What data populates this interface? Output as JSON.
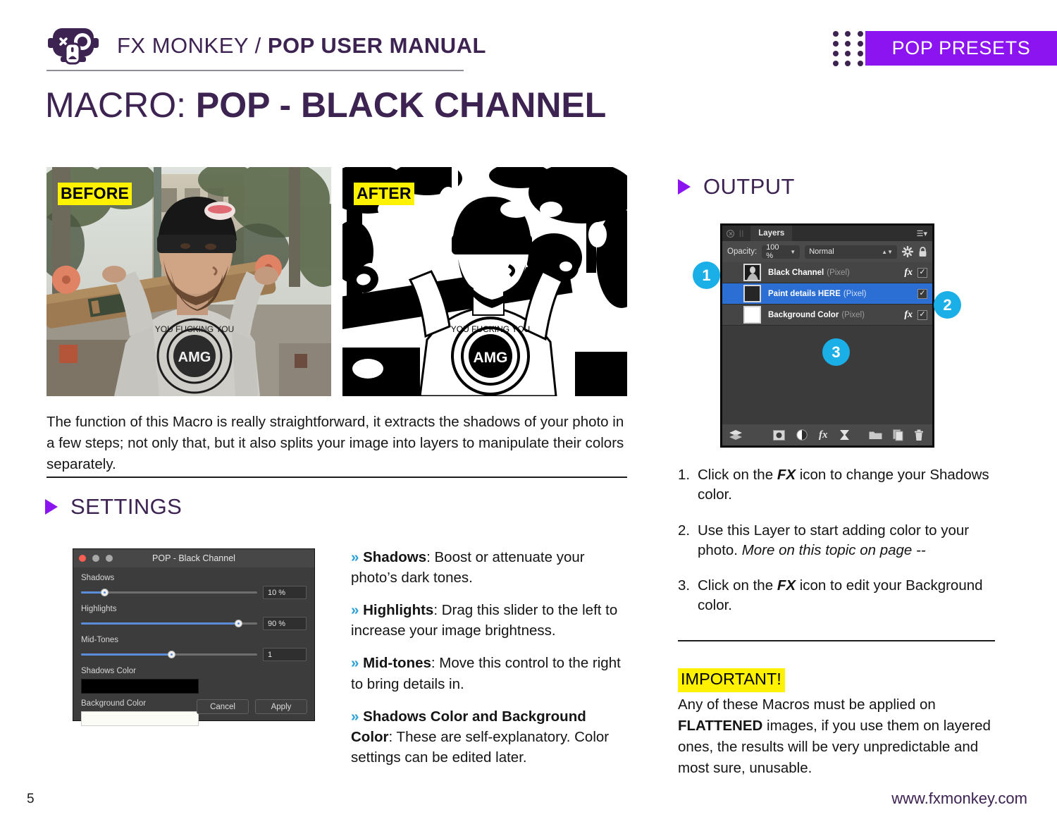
{
  "header": {
    "brand_light": "FX MONKEY / ",
    "brand_bold": "POP USER MANUAL",
    "logo_icon": "fx-monkey-logo-icon",
    "preset_tag": "POP PRESETS",
    "dot_grid_icon": "dot-grid-icon",
    "accent_purple": "#8b14f0",
    "dark_purple": "#3d2352"
  },
  "title": {
    "light": "MACRO: ",
    "bold": "POP - BLACK CHANNEL"
  },
  "photos": {
    "before": {
      "label": "BEFORE",
      "alt": "Color photo of bearded man wearing black beanie carrying a longboard on his shoulders"
    },
    "after": {
      "label": "AFTER",
      "alt": "High contrast black and white version of the same photo"
    },
    "highlight_color": "#fff200"
  },
  "description": "The function of this Macro is really straightforward, it extracts the shadows of your photo in a few steps; not only that, but it also splits your image into layers to manipulate their colors separately.",
  "sections": {
    "settings": {
      "label": "SETTINGS",
      "icon": "triangle-right-icon"
    },
    "output": {
      "label": "OUTPUT",
      "icon": "triangle-right-icon"
    }
  },
  "dialog": {
    "title": "POP - Black Channel",
    "traffic_lights": [
      "#ff5f52",
      "#a8a8a8",
      "#a8a8a8"
    ],
    "fields": [
      {
        "label": "Shadows",
        "value": "10 %",
        "fill_pct": 13
      },
      {
        "label": "Highlights",
        "value": "90 %",
        "fill_pct": 89
      },
      {
        "label": "Mid-Tones",
        "value": "1",
        "fill_pct": 51
      }
    ],
    "swatches": [
      {
        "label": "Shadows Color",
        "color": "#000000"
      },
      {
        "label": "Background Color",
        "color": "#fcfcf7"
      }
    ],
    "cancel_label": "Cancel",
    "apply_label": "Apply"
  },
  "settings_bullets": [
    {
      "marker": "»",
      "term": "Shadows",
      "text": ": Boost or attenuate your photo’s dark tones."
    },
    {
      "marker": "»",
      "term": "Highlights",
      "text": ": Drag this slider to the left to increase your image brightness."
    },
    {
      "marker": "»",
      "term": "Mid-tones",
      "text": ": Move this control to the right to bring details in."
    },
    {
      "marker": "»",
      "term": "Shadows Color and Background Color",
      "text": ": These are self-explanatory. Color settings can be edited later."
    }
  ],
  "layers_panel": {
    "tab_label": "Layers",
    "close_icon": "close-circle-icon",
    "pause_icon": "pause-bars-icon",
    "menu_icon": "panel-menu-icon",
    "opacity_label": "Opacity:",
    "opacity_value": "100 %",
    "blend_mode": "Normal",
    "gear_icon": "gear-icon",
    "lock_icon": "lock-icon",
    "layers": [
      {
        "name": "Black Channel",
        "type": "(Pixel)",
        "selected": false,
        "has_fx": true,
        "checked": true,
        "thumb": "photo-thumb"
      },
      {
        "name": "Paint details HERE",
        "type": "(Pixel)",
        "selected": true,
        "has_fx": false,
        "checked": true,
        "thumb": "dark-thumb"
      },
      {
        "name": "Background Color",
        "type": "(Pixel)",
        "selected": false,
        "has_fx": true,
        "checked": true,
        "thumb": "white-thumb"
      }
    ],
    "bottom_icons": [
      "layers-stack-icon",
      "mask-icon",
      "adjustment-icon",
      "fx-icon",
      "filter-hourglass-icon",
      "folder-icon",
      "duplicate-icon",
      "trash-icon"
    ],
    "selected_color": "#2b6ed4",
    "badges": [
      "1",
      "2",
      "3"
    ],
    "badge_color": "#1aafe6"
  },
  "steps": [
    {
      "num": "1.",
      "pre": "Click on the ",
      "bold": "FX",
      "post": " icon to change your Shadows color.",
      "italic": ""
    },
    {
      "num": "2.",
      "pre": "Use this Layer to start adding color to your photo. ",
      "bold": "",
      "post": "",
      "italic": "More on this topic on page --"
    },
    {
      "num": "3.",
      "pre": "Click on the ",
      "bold": "FX",
      "post": " icon to edit your Background color.",
      "italic": ""
    }
  ],
  "important": {
    "tag": "IMPORTANT!",
    "pre": "Any of these Macros must be applied on ",
    "bold": "FLATTENED",
    "post": " images, if you use them on layered ones, the results will be very unpredictable and most sure, unusable."
  },
  "footer": {
    "page_number": "5",
    "website": "www.fxmonkey.com"
  }
}
